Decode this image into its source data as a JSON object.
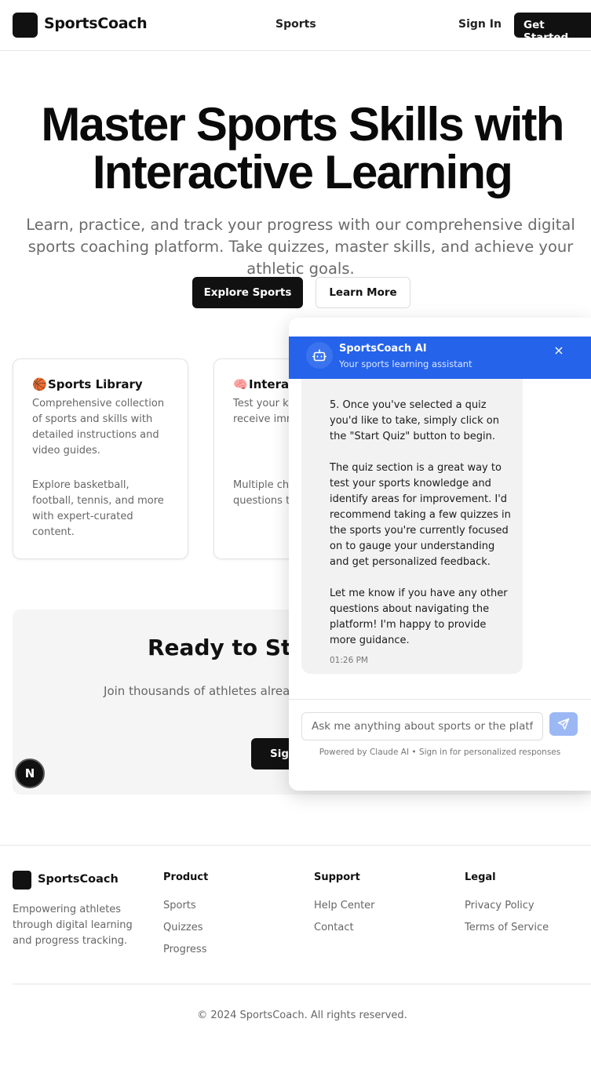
{
  "header": {
    "logo_text": "SportsCoach",
    "nav_sports": "Sports",
    "sign_in": "Sign In",
    "get_started": "Get Started"
  },
  "hero": {
    "title": "Master Sports Skills with Interactive Learning",
    "subtitle": "Learn, practice, and track your progress with our comprehensive digital sports coaching platform. Take quizzes, master skills, and achieve your athletic goals.",
    "explore_label": "Explore Sports",
    "learn_more_label": "Learn More"
  },
  "features": [
    {
      "emoji": "🏀",
      "title": "Sports Library",
      "p1": "Comprehensive collection of sports and skills with detailed instructions and video guides.",
      "p2": "Explore basketball, football, tennis, and more with expert-curated content."
    },
    {
      "emoji": "🧠",
      "title": "Interac",
      "p1": "Test your kr engaging qu receive imm feedback.",
      "p2": "Multiple ch and scenar questions t your unders"
    }
  ],
  "cta": {
    "title": "Ready to Star",
    "text": "Join thousands of athletes already improvi today and track your pro",
    "button": "Sign",
    "badge": "N"
  },
  "chat": {
    "name": "SportsCoach AI",
    "subtitle": "Your sports learning assistant",
    "close_glyph": "×",
    "message_paragraphs": [
      "5. Once you've selected a quiz you'd like to take, simply click on the \"Start Quiz\" button to begin.",
      "The quiz section is a great way to test your sports knowledge and identify areas for improvement. I'd recommend taking a few quizzes in the sports you're currently focused on to gauge your understanding and get personalized feedback.",
      "Let me know if you have any other questions about navigating the platform! I'm happy to provide more guidance."
    ],
    "message_time": "01:26 PM",
    "input_placeholder": "Ask me anything about sports or the platform...",
    "powered_by": "Powered by Claude AI • Sign in for personalized responses",
    "accent_color": "#2563eb"
  },
  "footer": {
    "logo_text": "SportsCoach",
    "description": "Empowering athletes through digital learning and progress tracking.",
    "columns": [
      {
        "title": "Product",
        "links": [
          "Sports",
          "Quizzes",
          "Progress"
        ]
      },
      {
        "title": "Support",
        "links": [
          "Help Center",
          "Contact"
        ]
      },
      {
        "title": "Legal",
        "links": [
          "Privacy Policy",
          "Terms of Service"
        ]
      }
    ],
    "copyright": "© 2024 SportsCoach. All rights reserved."
  }
}
